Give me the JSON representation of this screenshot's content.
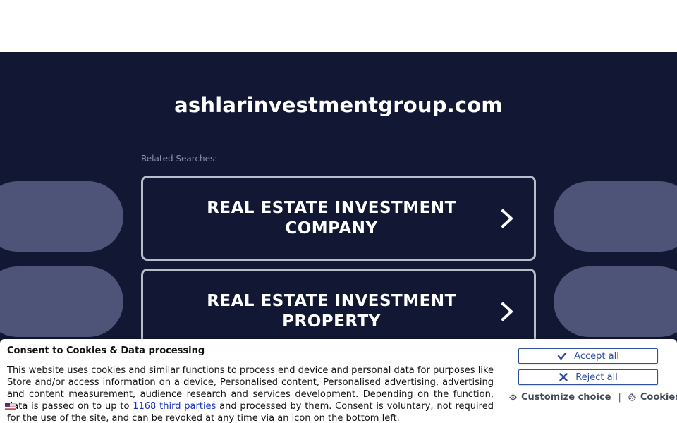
{
  "main": {
    "domain": "ashlarinvestmentgroup.com",
    "related_label": "Related Searches:",
    "searches": [
      {
        "line1": "REAL ESTATE INVESTMENT",
        "line2": "COMPANY"
      },
      {
        "line1": "REAL ESTATE INVESTMENT",
        "line2": "PROPERTY"
      }
    ]
  },
  "cookie": {
    "title": "Consent to Cookies & Data processing",
    "text_before_link": "This website uses cookies and similar functions to process end device and personal data for purposes like Store and/or access information on a device, Personalised content, Personalised advertising, advertising and content measurement, audience research and services development. Depending on the function, data is passed on to up to ",
    "link_text": "1168 third parties",
    "text_after_link": " and processed by them. Consent is voluntary, not required for the use of the site, and can be revoked at any time via an icon on the bottom left.",
    "accept_label": "Accept all",
    "reject_label": "Reject all",
    "customize_label": "Customize choice",
    "separator": "|",
    "cookies_label": "Cookies"
  },
  "colors": {
    "background": "#121733",
    "pill": "#4d5478",
    "button_border": "#b9bcc9",
    "consent_accent": "#2f4fa0",
    "link": "#1a2fbf"
  },
  "icons": {
    "chevron": "chevron-right-icon",
    "accept": "check-icon",
    "reject": "close-icon",
    "customize": "gear-icon",
    "cookies": "cookie-icon",
    "language": "flag-icon"
  }
}
